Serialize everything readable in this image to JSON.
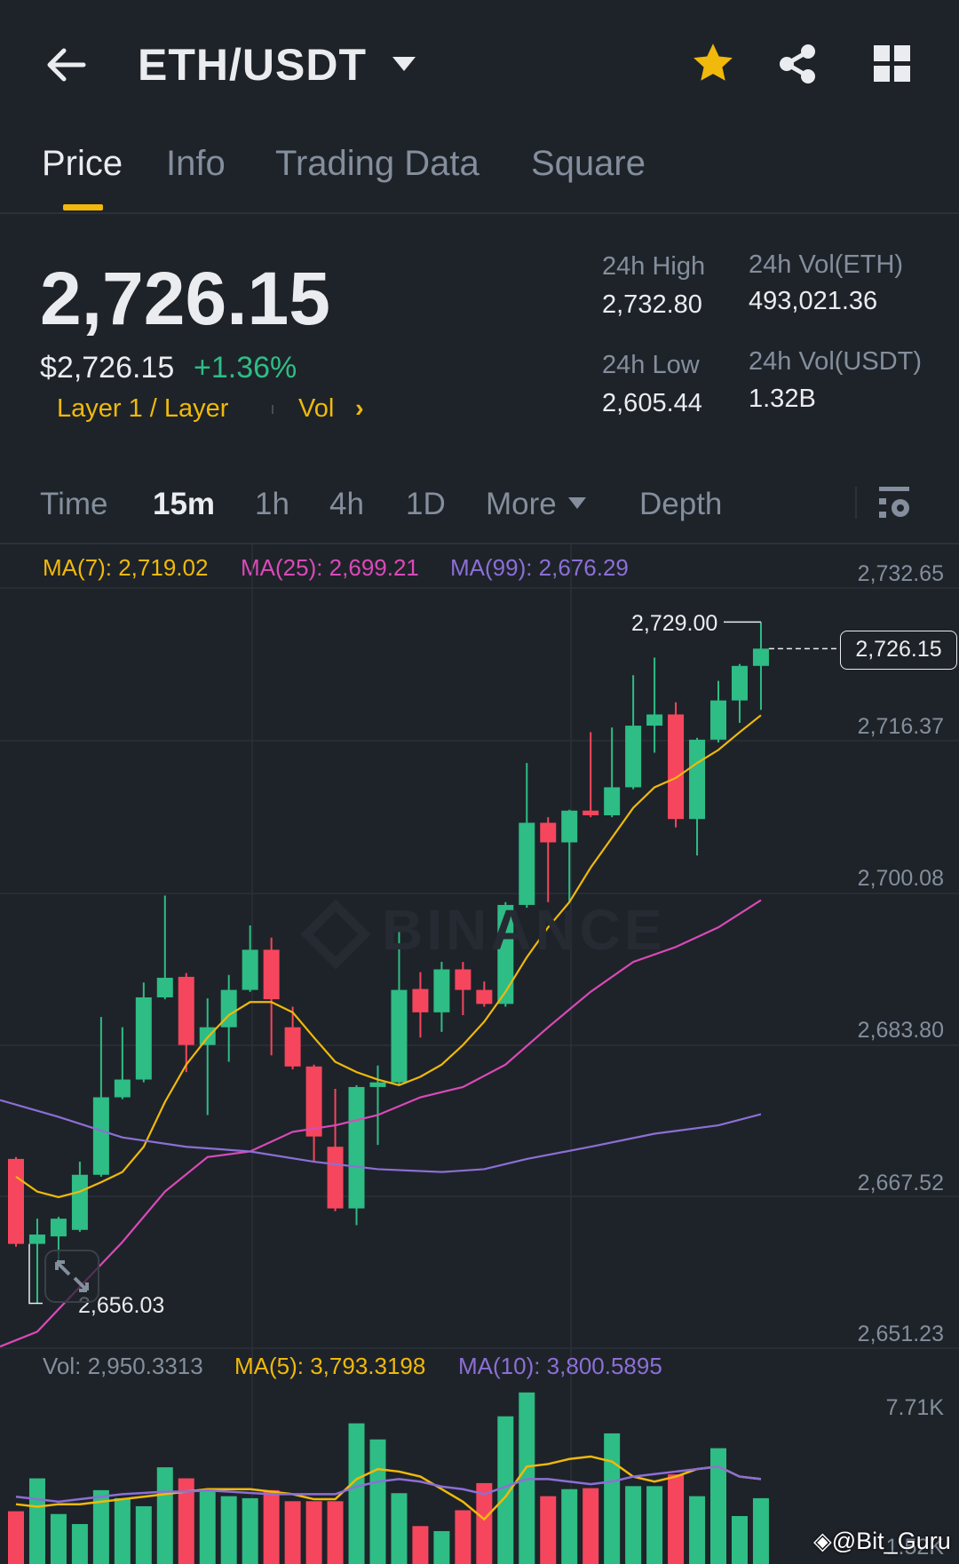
{
  "header": {
    "title": "ETH/USDT",
    "icons": [
      "back-arrow-icon",
      "caret-down-icon",
      "star-icon",
      "share-icon",
      "grid-icon"
    ]
  },
  "tabs": [
    {
      "label": "Price",
      "active": true
    },
    {
      "label": "Info"
    },
    {
      "label": "Trading Data"
    },
    {
      "label": "Square"
    }
  ],
  "ticker": {
    "last_price": "2,726.15",
    "usd_price": "$2,726.15",
    "change": "+1.36%",
    "tag": "Layer 1 / Layer",
    "vol_link": "Vol",
    "chevron": "›",
    "high_label": "24h High",
    "high": "2,732.80",
    "low_label": "24h Low",
    "low": "2,605.44",
    "vol_eth_label": "24h Vol(ETH)",
    "vol_eth": "493,021.36",
    "vol_usdt_label": "24h Vol(USDT)",
    "vol_usdt": "1.32B"
  },
  "timeframes": {
    "items": [
      "Time",
      "15m",
      "1h",
      "4h",
      "1D",
      "More",
      "Depth"
    ],
    "active": "15m"
  },
  "indicators": {
    "ma7": "MA(7): 2,719.02",
    "ma25": "MA(25): 2,699.21",
    "ma99": "MA(99): 2,676.29",
    "vol": "Vol: 2,950.3313",
    "vol_ma5": "MA(5): 3,793.3198",
    "vol_ma10": "MA(10): 3,800.5895"
  },
  "colors": {
    "bg": "#1E2329",
    "up": "#2EBD85",
    "down": "#F6465D",
    "accent": "#F0B90B",
    "ma7": "#F0B90B",
    "ma25": "#D94AB8",
    "ma99": "#8C6FD6",
    "text_muted": "#848E9C"
  },
  "watermark": "BINANCE",
  "credit": "@Bit_Guru",
  "chart_data": {
    "type": "candlestick",
    "interval": "15m",
    "price_axis_ticks": [
      "2,732.65",
      "2,716.37",
      "2,700.08",
      "2,683.80",
      "2,667.52",
      "2,651.23"
    ],
    "price_range": [
      2651.23,
      2732.65
    ],
    "volume_axis_ticks": [
      "7.71K",
      "1.52K"
    ],
    "volume_range_k": [
      1.52,
      7.71
    ],
    "current_price_label": "2,726.15",
    "high_marker_label": "2,729.00",
    "low_marker_label": "2,656.03",
    "candles": [
      [
        2671.5,
        2671.7,
        2662.1,
        2662.4
      ],
      [
        2662.4,
        2665.1,
        2656.03,
        2663.4
      ],
      [
        2663.2,
        2665.3,
        2660.4,
        2665.1
      ],
      [
        2663.9,
        2671.2,
        2663.7,
        2669.8
      ],
      [
        2669.8,
        2686.7,
        2669.6,
        2678.1
      ],
      [
        2678.1,
        2685.6,
        2677.9,
        2680.0
      ],
      [
        2680.0,
        2690.4,
        2679.7,
        2688.8
      ],
      [
        2688.8,
        2699.7,
        2688.6,
        2690.9
      ],
      [
        2691.0,
        2691.4,
        2680.8,
        2683.7
      ],
      [
        2683.7,
        2688.7,
        2676.2,
        2685.6
      ],
      [
        2685.6,
        2691.2,
        2681.9,
        2689.6
      ],
      [
        2689.6,
        2696.5,
        2689.4,
        2693.9
      ],
      [
        2693.9,
        2695.2,
        2682.6,
        2688.6
      ],
      [
        2685.6,
        2687.8,
        2681.1,
        2681.4
      ],
      [
        2681.4,
        2681.6,
        2671.2,
        2673.9
      ],
      [
        2672.8,
        2679.0,
        2665.9,
        2666.2
      ],
      [
        2666.2,
        2679.4,
        2664.4,
        2679.2
      ],
      [
        2679.2,
        2681.5,
        2673.0,
        2679.7
      ],
      [
        2679.7,
        2696.1,
        2679.5,
        2689.6
      ],
      [
        2689.7,
        2691.5,
        2684.5,
        2687.2
      ],
      [
        2687.2,
        2692.6,
        2685.1,
        2691.8
      ],
      [
        2691.8,
        2692.6,
        2686.9,
        2689.6
      ],
      [
        2689.6,
        2690.5,
        2687.8,
        2688.1
      ],
      [
        2688.1,
        2699.0,
        2687.8,
        2698.7
      ],
      [
        2698.7,
        2713.9,
        2698.4,
        2707.5
      ],
      [
        2707.5,
        2708.1,
        2699.0,
        2705.4
      ],
      [
        2705.4,
        2708.9,
        2699.0,
        2708.8
      ],
      [
        2708.8,
        2717.2,
        2708.1,
        2708.3
      ],
      [
        2708.3,
        2717.7,
        2708.1,
        2711.3
      ],
      [
        2711.3,
        2723.3,
        2711.1,
        2717.9
      ],
      [
        2717.9,
        2725.2,
        2715.0,
        2719.1
      ],
      [
        2719.1,
        2720.4,
        2707.0,
        2707.9
      ],
      [
        2707.9,
        2716.6,
        2704.0,
        2716.4
      ],
      [
        2716.4,
        2722.7,
        2716.1,
        2720.6
      ],
      [
        2720.6,
        2724.5,
        2718.2,
        2724.3
      ],
      [
        2724.3,
        2729.0,
        2719.6,
        2726.15
      ]
    ],
    "candle_format": [
      "open",
      "high",
      "low",
      "close"
    ],
    "ma7": [
      2669.6,
      2668.0,
      2667.4,
      2668.0,
      2669.0,
      2670.1,
      2672.8,
      2677.6,
      2681.6,
      2684.5,
      2686.9,
      2688.3,
      2688.3,
      2687.2,
      2684.5,
      2681.9,
      2680.8,
      2680.0,
      2679.4,
      2680.3,
      2681.6,
      2683.7,
      2686.2,
      2689.4,
      2693.1,
      2696.3,
      2699.0,
      2702.7,
      2705.9,
      2709.1,
      2711.3,
      2712.3,
      2713.9,
      2715.3,
      2717.2,
      2719.02
    ],
    "ma25_points": [
      [
        -0.75,
        2651.4
      ],
      [
        1,
        2653.0
      ],
      [
        3,
        2657.8
      ],
      [
        5,
        2662.6
      ],
      [
        7,
        2668.0
      ],
      [
        9,
        2671.7
      ],
      [
        11,
        2672.3
      ],
      [
        13,
        2674.4
      ],
      [
        15,
        2675.1
      ],
      [
        17,
        2676.2
      ],
      [
        19,
        2678.1
      ],
      [
        21,
        2679.2
      ],
      [
        23,
        2681.6
      ],
      [
        25,
        2685.6
      ],
      [
        27,
        2689.4
      ],
      [
        29,
        2692.6
      ],
      [
        31,
        2694.2
      ],
      [
        33,
        2696.3
      ],
      [
        35,
        2699.21
      ]
    ],
    "ma99_points": [
      [
        -0.75,
        2677.8
      ],
      [
        2,
        2676.0
      ],
      [
        5,
        2673.8
      ],
      [
        8,
        2672.8
      ],
      [
        11,
        2672.3
      ],
      [
        14,
        2671.2
      ],
      [
        17,
        2670.4
      ],
      [
        20,
        2670.1
      ],
      [
        22,
        2670.4
      ],
      [
        24,
        2671.5
      ],
      [
        27,
        2672.8
      ],
      [
        30,
        2674.2
      ],
      [
        33,
        2675.1
      ],
      [
        35,
        2676.29
      ]
    ],
    "volume_k": [
      3.62,
      4.93,
      3.51,
      3.11,
      4.46,
      4.14,
      3.82,
      5.37,
      4.93,
      4.46,
      4.22,
      4.14,
      4.46,
      4.02,
      4.02,
      4.02,
      7.12,
      6.48,
      4.34,
      3.03,
      2.83,
      3.66,
      4.74,
      7.4,
      8.35,
      4.22,
      4.5,
      4.54,
      6.72,
      4.62,
      4.62,
      5.09,
      4.22,
      6.13,
      3.43,
      4.14
    ],
    "volume_ma5_k": [
      3.9,
      3.8,
      3.9,
      3.9,
      4.0,
      4.1,
      4.2,
      4.3,
      4.4,
      4.5,
      4.5,
      4.5,
      4.4,
      4.3,
      4.1,
      4.1,
      4.9,
      5.3,
      5.2,
      5.0,
      4.5,
      4.0,
      3.3,
      4.2,
      5.4,
      5.5,
      5.7,
      5.8,
      5.6,
      5.0,
      4.8,
      5.0,
      5.3,
      5.4,
      5.0,
      4.9
    ],
    "volume_ma10_k": [
      4.2,
      4.1,
      4.0,
      4.1,
      4.2,
      4.3,
      4.35,
      4.4,
      4.4,
      4.45,
      4.4,
      4.35,
      4.3,
      4.3,
      4.3,
      4.3,
      4.6,
      4.8,
      4.9,
      4.8,
      4.6,
      4.5,
      4.3,
      4.6,
      4.9,
      4.9,
      4.8,
      4.7,
      4.8,
      5.0,
      5.1,
      5.2,
      5.3,
      5.4,
      5.0,
      4.9
    ]
  }
}
